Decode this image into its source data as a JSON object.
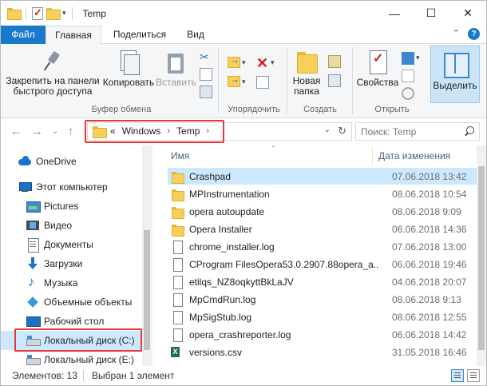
{
  "window": {
    "title": "Temp",
    "controls": {
      "minimize": "—",
      "maximize": "☐",
      "close": "✕"
    }
  },
  "ribbon_tabs": {
    "file": "Файл",
    "home": "Главная",
    "share": "Поделиться",
    "view": "Вид"
  },
  "ribbon": {
    "clipboard": {
      "pin_label": "Закрепить на панели быстрого доступа",
      "pin_line1": "Закрепить на панели",
      "pin_line2": "быстрого доступа",
      "copy": "Копировать",
      "paste": "Вставить",
      "group": "Буфер обмена"
    },
    "organize": {
      "group": "Упорядочить"
    },
    "new": {
      "new_folder_line1": "Новая",
      "new_folder_line2": "папка",
      "group": "Создать"
    },
    "open": {
      "properties": "Свойства",
      "group": "Открыть"
    },
    "select": {
      "select_label": "Выделить"
    }
  },
  "address": {
    "overflow": "«",
    "parts": [
      "Windows",
      "Temp"
    ],
    "search_placeholder": "Поиск: Temp"
  },
  "nav_pane": {
    "items": [
      {
        "label": "OneDrive",
        "icon": "onedrive-cloud-icon"
      },
      {
        "label": "Этот компьютер",
        "icon": "computer-icon"
      },
      {
        "label": "Pictures",
        "icon": "pictures-icon"
      },
      {
        "label": "Видео",
        "icon": "video-icon"
      },
      {
        "label": "Документы",
        "icon": "documents-icon"
      },
      {
        "label": "Загрузки",
        "icon": "downloads-icon"
      },
      {
        "label": "Музыка",
        "icon": "music-icon"
      },
      {
        "label": "Объемные объекты",
        "icon": "3d-objects-icon"
      },
      {
        "label": "Рабочий стол",
        "icon": "desktop-icon"
      },
      {
        "label": "Локальный диск (C:)",
        "icon": "drive-icon",
        "selected": true
      },
      {
        "label": "Локальный диск (E:)",
        "icon": "drive-icon"
      }
    ]
  },
  "file_list": {
    "columns": {
      "name": "Имя",
      "date": "Дата изменения"
    },
    "rows": [
      {
        "name": "Crashpad",
        "date": "07.06.2018 13:42",
        "type": "folder",
        "selected": true
      },
      {
        "name": "MPInstrumentation",
        "date": "08.06.2018 10:54",
        "type": "folder"
      },
      {
        "name": "opera autoupdate",
        "date": "08.06.2018 9:09",
        "type": "folder"
      },
      {
        "name": "Opera Installer",
        "date": "06.06.2018 14:36",
        "type": "folder"
      },
      {
        "name": "chrome_installer.log",
        "date": "07.06.2018 13:00",
        "type": "file"
      },
      {
        "name": "CProgram FilesOpera53.0.2907.88opera_a...",
        "date": "06.06.2018 19:46",
        "type": "file"
      },
      {
        "name": "etilqs_NZ8oqkyttBkLaJV",
        "date": "04.06.2018 20:07",
        "type": "file"
      },
      {
        "name": "MpCmdRun.log",
        "date": "08.06.2018 9:13",
        "type": "file"
      },
      {
        "name": "MpSigStub.log",
        "date": "08.06.2018 12:55",
        "type": "file"
      },
      {
        "name": "opera_crashreporter.log",
        "date": "06.06.2018 14:42",
        "type": "file"
      },
      {
        "name": "versions.csv",
        "date": "31.05.2018 16:46",
        "type": "csv"
      }
    ]
  },
  "status": {
    "count": "Элементов: 13",
    "selected": "Выбран 1 элемент"
  },
  "colors": {
    "accent": "#1979ca",
    "selection": "#cce8ff",
    "highlight_box": "#e53935"
  }
}
